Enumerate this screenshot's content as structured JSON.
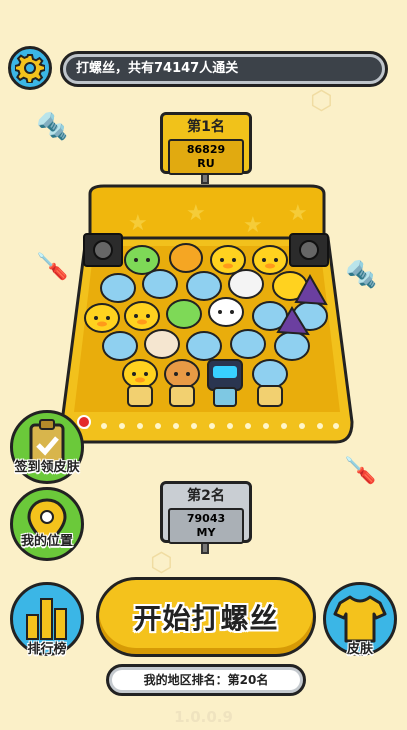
{
  "marquee": {
    "text": "打螺丝，共有74147人通关"
  },
  "rank1": {
    "title": "第1名",
    "score": "86829",
    "region": "RU"
  },
  "rank2": {
    "title": "第2名",
    "score": "79043",
    "region": "MY"
  },
  "buttons": {
    "signin": "签到领皮肤",
    "location": "我的位置",
    "leaderboard": "排行榜",
    "start": "开始打螺丝",
    "skin": "皮肤"
  },
  "region_rank": "我的地区排名：第20名",
  "version": "1.0.0.9",
  "colors": {
    "background": "#fbf0c8",
    "gold": "#f1c21a",
    "blue": "#3bb6e6",
    "green": "#6bc93a",
    "silver": "#c9ced3"
  },
  "icons": [
    "gear-icon",
    "clipboard-check-icon",
    "location-pin-icon",
    "bar-chart-icon",
    "tshirt-icon"
  ]
}
